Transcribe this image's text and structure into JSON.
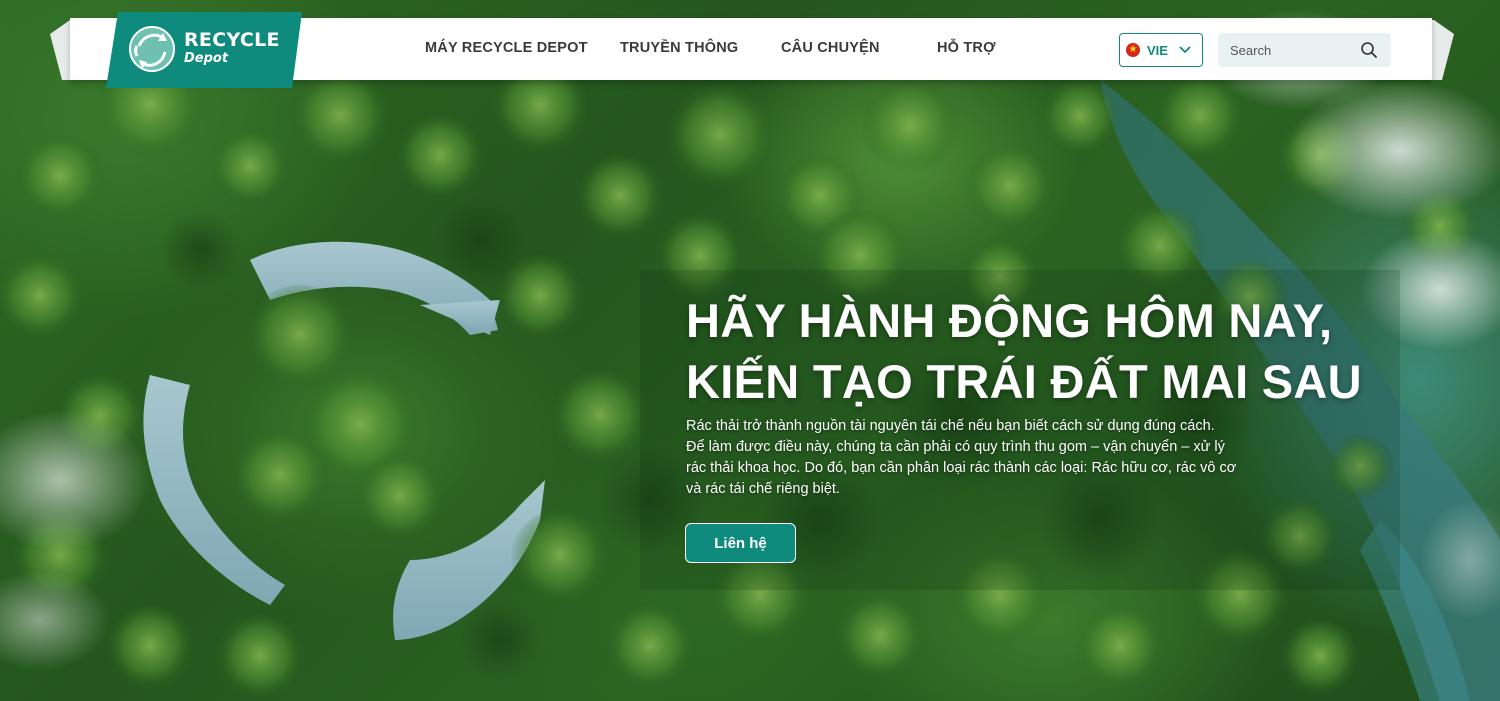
{
  "brand": {
    "name": "RECYCLE",
    "sub": "Depot",
    "color": "#0f8b7e"
  },
  "nav": {
    "items": [
      {
        "label": "MÁY RECYCLE DEPOT"
      },
      {
        "label": "TRUYỀN THÔNG"
      },
      {
        "label": "CÂU CHUYỆN"
      },
      {
        "label": "HỖ TRỢ"
      }
    ]
  },
  "language": {
    "code": "VIE",
    "flag_icon": "vietnam-flag-icon"
  },
  "search": {
    "placeholder": "Search",
    "icon": "search-icon"
  },
  "hero": {
    "headline_line1": "HÃY HÀNH ĐỘNG HÔM NAY,",
    "headline_line2": "KIẾN TẠO TRÁI ĐẤT MAI SAU",
    "body_line1": "Rác thải trở thành nguồn tài nguyên tái chế nếu bạn biết cách sử dụng đúng cách.",
    "body_line2": "Để làm được điều này, chúng ta cần phải có quy trình thu gom – vận chuyển – xử lý",
    "body_line3": "rác thải khoa học. Do đó, bạn cần phân loại rác thành các loại: Rác hữu cơ, rác vô cơ",
    "body_line4": "và rác tái chế riêng biệt.",
    "cta_label": "Liên hệ"
  }
}
